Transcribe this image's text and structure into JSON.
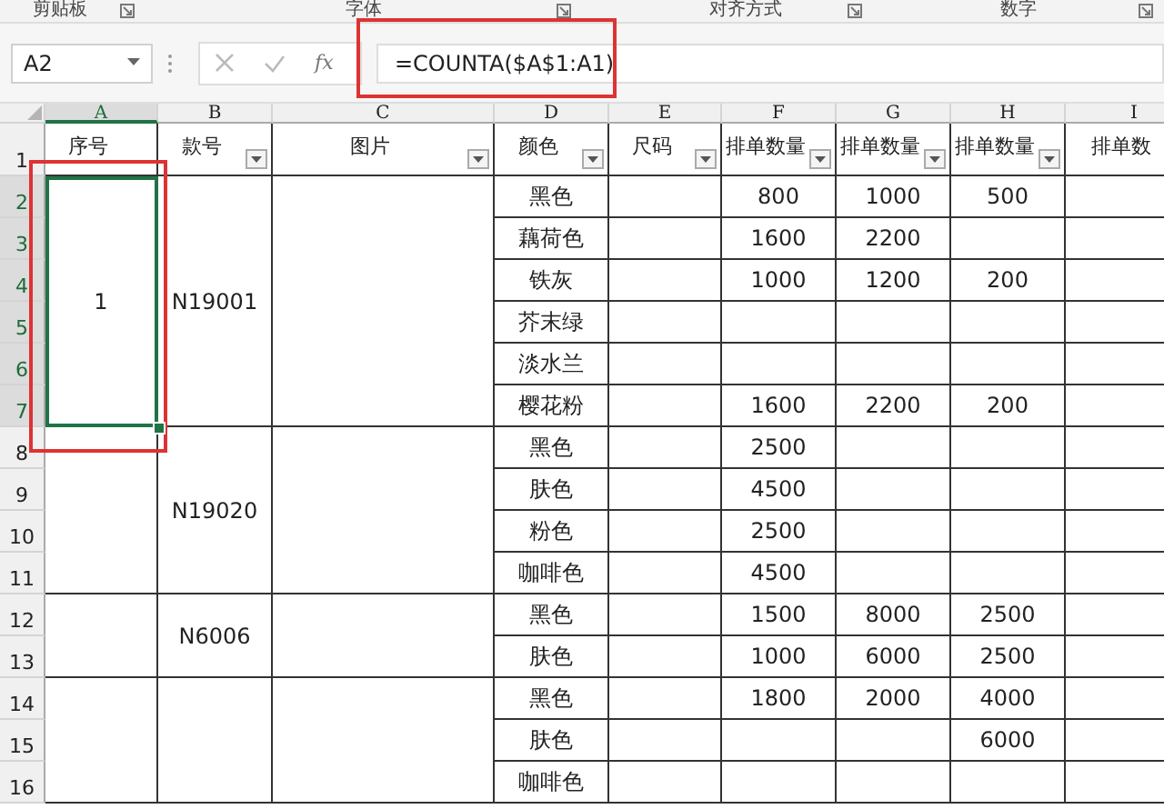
{
  "ribbon_groups": [
    "剪贴板",
    "字体",
    "对齐方式",
    "数字"
  ],
  "name_box": "A2",
  "fx": "fx",
  "formula": "=COUNTA($A$1:A1)",
  "columns": [
    {
      "label": "A",
      "selected": true
    },
    {
      "label": "B",
      "selected": false
    },
    {
      "label": "C",
      "selected": false
    },
    {
      "label": "D",
      "selected": false
    },
    {
      "label": "E",
      "selected": false
    },
    {
      "label": "F",
      "selected": false
    },
    {
      "label": "G",
      "selected": false
    },
    {
      "label": "H",
      "selected": false
    },
    {
      "label": "I",
      "selected": false
    }
  ],
  "row_numbers": [
    {
      "label": "1",
      "selected": false
    },
    {
      "label": "2",
      "selected": true
    },
    {
      "label": "3",
      "selected": true
    },
    {
      "label": "4",
      "selected": true
    },
    {
      "label": "5",
      "selected": true
    },
    {
      "label": "6",
      "selected": true
    },
    {
      "label": "7",
      "selected": true
    },
    {
      "label": "8",
      "selected": false
    },
    {
      "label": "9",
      "selected": false
    },
    {
      "label": "10",
      "selected": false
    },
    {
      "label": "11",
      "selected": false
    },
    {
      "label": "12",
      "selected": false
    },
    {
      "label": "13",
      "selected": false
    },
    {
      "label": "14",
      "selected": false
    },
    {
      "label": "15",
      "selected": false
    },
    {
      "label": "16",
      "selected": false
    }
  ],
  "header": [
    {
      "text": "序号",
      "filter": false
    },
    {
      "text": "款号",
      "filter": true
    },
    {
      "text": "图片",
      "filter": true
    },
    {
      "text": "颜色",
      "filter": true
    },
    {
      "text": "尺码",
      "filter": true
    },
    {
      "text": "排单数量",
      "filter": true
    },
    {
      "text": "排单数量",
      "filter": true
    },
    {
      "text": "排单数量",
      "filter": true
    },
    {
      "text": "排单数",
      "filter": false
    }
  ],
  "groups": [
    {
      "number": "1",
      "style": "N19001",
      "selected": true,
      "rows": [
        {
          "D": "黑色",
          "F": "800",
          "G": "1000",
          "H": "500"
        },
        {
          "D": "藕荷色",
          "F": "1600",
          "G": "2200"
        },
        {
          "D": "铁灰",
          "F": "1000",
          "G": "1200",
          "H": "200"
        },
        {
          "D": "芥末绿"
        },
        {
          "D": "淡水兰"
        },
        {
          "D": "樱花粉",
          "F": "1600",
          "G": "2200",
          "H": "200"
        }
      ]
    },
    {
      "style": "N19020",
      "selected": false,
      "rows": [
        {
          "D": "黑色",
          "F": "2500"
        },
        {
          "D": "肤色",
          "F": "4500"
        },
        {
          "D": "粉色",
          "F": "2500"
        },
        {
          "D": "咖啡色",
          "F": "4500"
        }
      ]
    },
    {
      "style": "N6006",
      "selected": false,
      "rows": [
        {
          "D": "黑色",
          "F": "1500",
          "G": "8000",
          "H": "2500"
        },
        {
          "D": "肤色",
          "F": "1000",
          "G": "6000",
          "H": "2500"
        }
      ]
    },
    {
      "selected": false,
      "rows": [
        {
          "D": "黑色",
          "F": "1800",
          "G": "2000",
          "H": "4000"
        },
        {
          "D": "肤色",
          "H": "6000"
        },
        {
          "D": "咖啡色"
        }
      ]
    }
  ]
}
